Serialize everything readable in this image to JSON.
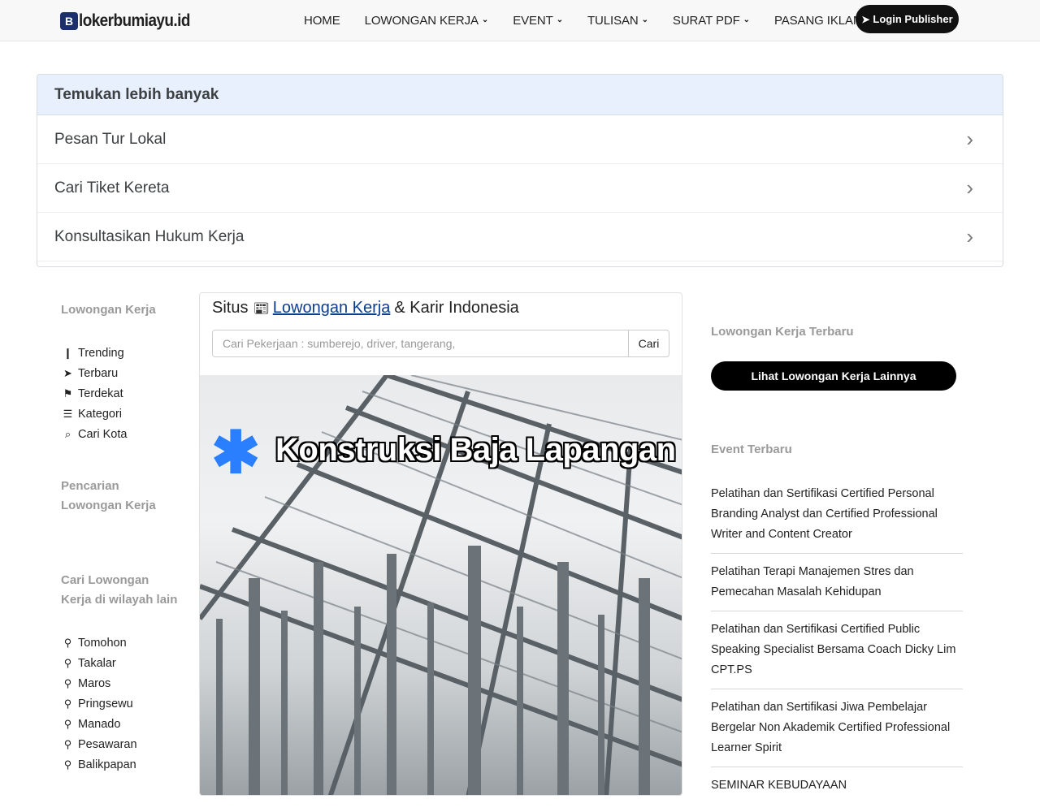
{
  "header": {
    "logo_mark": "B",
    "logo_text": "lokerbumiayu.id",
    "nav": [
      {
        "label": "HOME",
        "dropdown": false
      },
      {
        "label": "LOWONGAN KERJA",
        "dropdown": true
      },
      {
        "label": "EVENT",
        "dropdown": true
      },
      {
        "label": "TULISAN",
        "dropdown": true
      },
      {
        "label": "SURAT PDF",
        "dropdown": true
      },
      {
        "label": "PASANG IKLAN",
        "dropdown": false
      }
    ],
    "login_label": "Login Publisher"
  },
  "findmore": {
    "title": "Temukan lebih banyak",
    "items": [
      "Pesan Tur Lokal",
      "Cari Tiket Kereta",
      "Konsultasikan Hukum Kerja"
    ]
  },
  "left": {
    "section1_title": "Lowongan Kerja",
    "menu": [
      {
        "icon": "chart-icon",
        "label": "Trending"
      },
      {
        "icon": "paper-plane-icon",
        "label": "Terbaru"
      },
      {
        "icon": "map-marker-icon",
        "label": "Terdekat"
      },
      {
        "icon": "list-icon",
        "label": "Kategori"
      },
      {
        "icon": "search-location-icon",
        "label": "Cari Kota"
      }
    ],
    "section2_title": "Pencarian Lowongan Kerja",
    "section3_title": "Cari Lowongan Kerja di wilayah lain",
    "cities": [
      "Tomohon",
      "Takalar",
      "Maros",
      "Pringsewu",
      "Manado",
      "Pesawaran",
      "Balikpapan"
    ]
  },
  "center": {
    "title_prefix": "Situs",
    "title_link": "Lowongan Kerja",
    "title_suffix": "& Karir Indonesia",
    "search_placeholder": "Cari Pekerjaan : sumberejo, driver, tangerang,",
    "search_button": "Cari",
    "hero_caption": "Konstruksi Baja Lapangan P"
  },
  "right": {
    "latest_jobs_title": "Lowongan Kerja Terbaru",
    "more_jobs_button": "Lihat Lowongan Kerja Lainnya",
    "events_title": "Event Terbaru",
    "events": [
      "Pelatihan dan Sertifikasi Certified Personal Branding Analyst dan Certified Professional Writer and Content Creator",
      "Pelatihan Terapi Manajemen Stres dan Pemecahan Masalah Kehidupan",
      "Pelatihan dan Sertifikasi Certified Public Speaking Specialist Bersama Coach Dicky Lim CPT.PS",
      "Pelatihan dan Sertifikasi Jiwa Pembelajar Bergelar Non Akademik Certified Professional Learner Spirit",
      "SEMINAR KEBUDAYAAN"
    ]
  }
}
